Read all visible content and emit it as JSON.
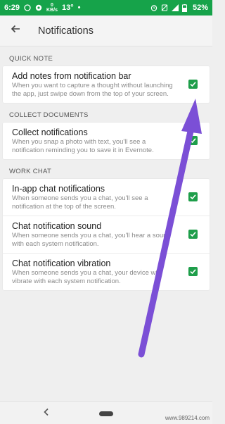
{
  "status_bar": {
    "time": "6:29",
    "speed": "KB/s",
    "speed_value": "0",
    "temperature": "13°",
    "battery": "52%",
    "background_color": "#16a34a"
  },
  "app_bar": {
    "back_icon": "arrow-left-icon",
    "title": "Notifications"
  },
  "sections": [
    {
      "header": "QUICK NOTE",
      "rows": [
        {
          "title": "Add notes from notification bar",
          "description": "When you want to capture a thought without launching the app, just swipe down from the top of your screen.",
          "checked": true
        }
      ]
    },
    {
      "header": "COLLECT DOCUMENTS",
      "rows": [
        {
          "title": "Collect notifications",
          "description": "When you snap a photo with text, you'll see a notification reminding you to save it in Evernote.",
          "checked": true
        }
      ]
    },
    {
      "header": "WORK CHAT",
      "rows": [
        {
          "title": "In-app chat notifications",
          "description": "When someone sends you a chat, you'll see a notification at the top of the screen.",
          "checked": true
        },
        {
          "title": "Chat notification sound",
          "description": "When someone sends you a chat, you'll hear a sound with each system notification.",
          "checked": true
        },
        {
          "title": "Chat notification vibration",
          "description": "When someone sends you a chat, your device will vibrate with each system notification.",
          "checked": true
        }
      ]
    }
  ],
  "colors": {
    "checkbox": "#1e9e4a",
    "arrow": "#7b4fd6"
  },
  "watermark": "www.989214.com"
}
